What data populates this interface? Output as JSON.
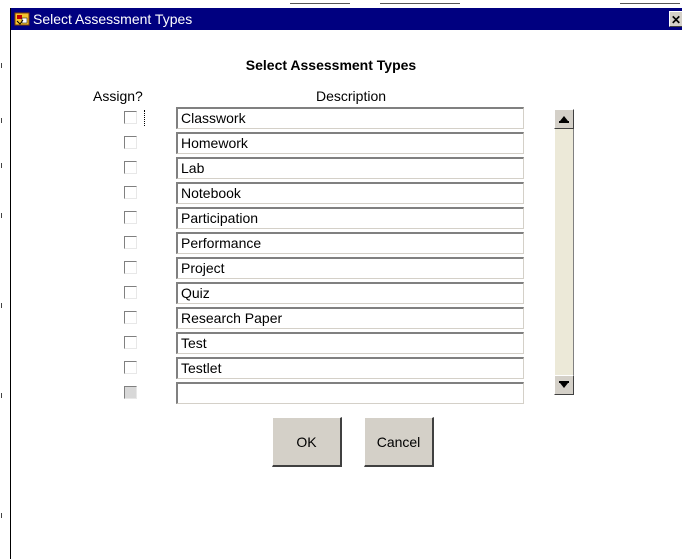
{
  "window": {
    "title": "Select Assessment Types",
    "close_label": "✕"
  },
  "dialog": {
    "heading": "Select Assessment Types",
    "columns": {
      "assign": "Assign?",
      "description": "Description"
    },
    "rows": [
      {
        "description": "Classwork",
        "checked": false
      },
      {
        "description": "Homework",
        "checked": false
      },
      {
        "description": "Lab",
        "checked": false
      },
      {
        "description": "Notebook",
        "checked": false
      },
      {
        "description": "Participation",
        "checked": false
      },
      {
        "description": "Performance",
        "checked": false
      },
      {
        "description": "Project",
        "checked": false
      },
      {
        "description": "Quiz",
        "checked": false
      },
      {
        "description": "Research Paper",
        "checked": false
      },
      {
        "description": "Test",
        "checked": false
      },
      {
        "description": "Testlet",
        "checked": false
      },
      {
        "description": "",
        "checked": false,
        "disabled": true
      }
    ],
    "buttons": {
      "ok": "OK",
      "cancel": "Cancel"
    }
  },
  "icons": {
    "title": "app-window-icon",
    "scroll_up": "arrow-up-icon",
    "scroll_down": "arrow-down-icon"
  },
  "colors": {
    "titlebar": "#000080",
    "button_face": "#d4d0c8"
  }
}
